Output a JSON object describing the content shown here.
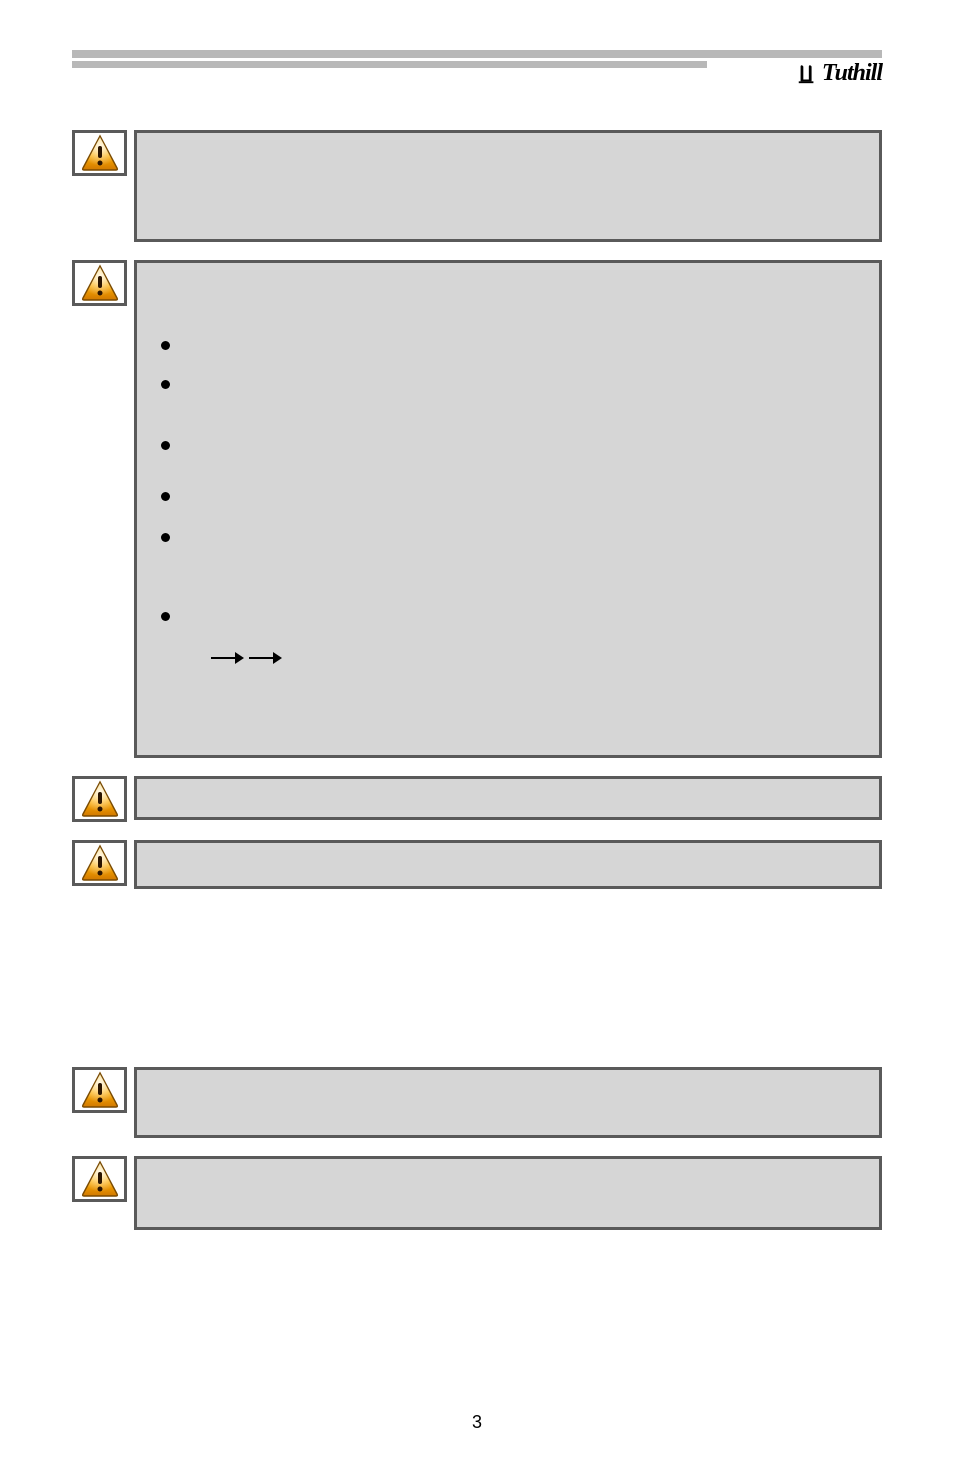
{
  "brand": {
    "name": "Tuthill"
  },
  "callouts": {
    "group1": [
      {
        "id": "c1",
        "icon": "warning-icon",
        "text": ""
      },
      {
        "id": "c2",
        "icon": "warning-icon",
        "text": "",
        "bullets": [
          "",
          "",
          "",
          "",
          "",
          ""
        ],
        "arrows": [
          "",
          ""
        ]
      },
      {
        "id": "c3",
        "icon": "warning-icon",
        "text": ""
      },
      {
        "id": "c4",
        "icon": "warning-icon",
        "text": ""
      }
    ],
    "group2": [
      {
        "id": "c5",
        "icon": "warning-icon",
        "text": ""
      },
      {
        "id": "c6",
        "icon": "warning-icon",
        "text": ""
      }
    ]
  },
  "page_number": "3"
}
